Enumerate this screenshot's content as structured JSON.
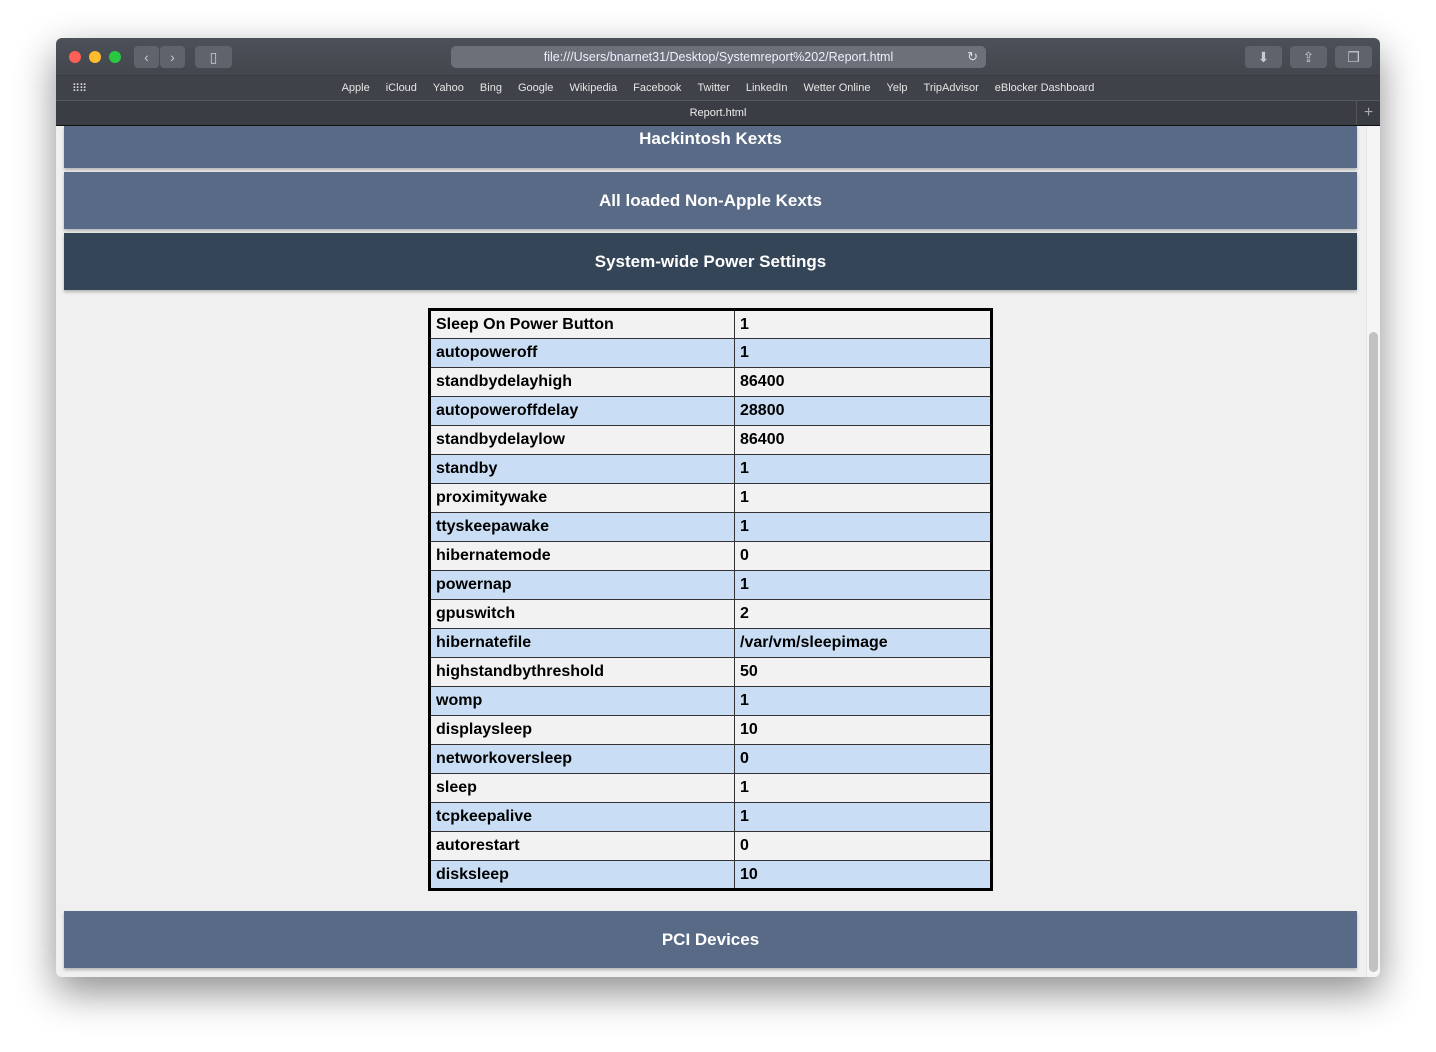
{
  "browser": {
    "url": "file:///Users/bnarnet31/Desktop/Systemreport%202/Report.html",
    "tab_title": "Report.html",
    "bookmarks": [
      "Apple",
      "iCloud",
      "Yahoo",
      "Bing",
      "Google",
      "Wikipedia",
      "Facebook",
      "Twitter",
      "LinkedIn",
      "Wetter Online",
      "Yelp",
      "TripAdvisor",
      "eBlocker Dashboard"
    ]
  },
  "sections": {
    "hackintosh": "Hackintosh Kexts",
    "nonapple": "All loaded Non-Apple Kexts",
    "power": "System-wide Power Settings",
    "pci": "PCI Devices"
  },
  "power_table": [
    [
      "Sleep On Power Button",
      "1"
    ],
    [
      "autopoweroff",
      "1"
    ],
    [
      "standbydelayhigh",
      "86400"
    ],
    [
      "autopoweroffdelay",
      "28800"
    ],
    [
      "standbydelaylow",
      "86400"
    ],
    [
      "standby",
      "1"
    ],
    [
      "proximitywake",
      "1"
    ],
    [
      "ttyskeepawake",
      "1"
    ],
    [
      "hibernatemode",
      "0"
    ],
    [
      "powernap",
      "1"
    ],
    [
      "gpuswitch",
      "2"
    ],
    [
      "hibernatefile",
      "/var/vm/sleepimage"
    ],
    [
      "highstandbythreshold",
      "50"
    ],
    [
      "womp",
      "1"
    ],
    [
      "displaysleep",
      "10"
    ],
    [
      "networkoversleep",
      "0"
    ],
    [
      "sleep",
      "1"
    ],
    [
      "tcpkeepalive",
      "1"
    ],
    [
      "autorestart",
      "0"
    ],
    [
      "disksleep",
      "10"
    ]
  ]
}
